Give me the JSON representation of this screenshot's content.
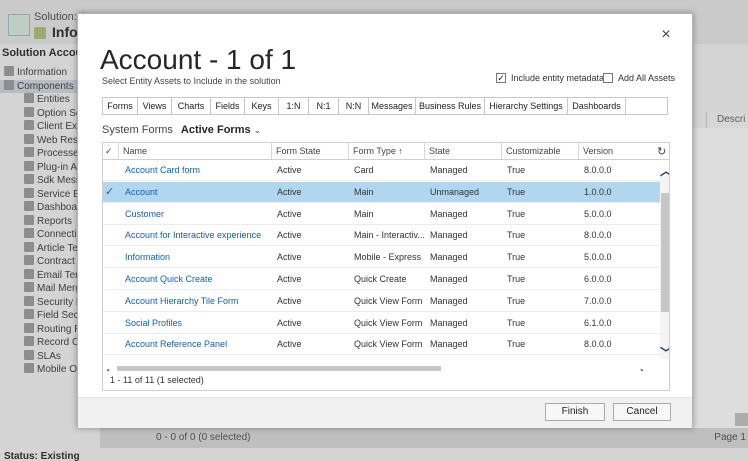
{
  "background": {
    "solution_label": "Solution: A",
    "info_title": "Infor",
    "solution_account": "Solution Account",
    "nav": {
      "information": "Information",
      "components": "Components",
      "items": [
        "Entities",
        "Option Set",
        "Client Exte",
        "Web Resou",
        "Processes",
        "Plug-in Ass",
        "Sdk Messag",
        "Service End",
        "Dashboard",
        "Reports",
        "Connection",
        "Article Tem",
        "Contract Te",
        "Email Temp",
        "Mail Merge",
        "Security Ro",
        "Field Secur",
        "Routing Ru",
        "Record Cre",
        "SLAs",
        "Mobile Offl"
      ]
    },
    "right_header": "Descri",
    "footer_count": "0 - 0 of 0 (0 selected)",
    "footer_page": "Page 1",
    "status": "Status: Existing"
  },
  "dialog": {
    "title": "Account - 1 of 1",
    "subtitle": "Select Entity Assets to Include in the solution",
    "close_glyph": "×",
    "include_metadata": {
      "label": "Include entity metadata",
      "checked": true
    },
    "add_all_assets": {
      "label": "Add All Assets",
      "checked": false
    },
    "tabs": [
      "Forms",
      "Views",
      "Charts",
      "Fields",
      "Keys",
      "1:N",
      "N:1",
      "N:N",
      "Messages",
      "Business Rules",
      "Hierarchy Settings",
      "Dashboards"
    ],
    "active_tab": "Forms",
    "view_label": "System Forms",
    "view_name": "Active Forms",
    "view_chevron": "⌄",
    "columns": {
      "check": "✓",
      "name": "Name",
      "form_state": "Form State",
      "form_type": "Form Type",
      "form_type_sort": "↑",
      "state": "State",
      "customizable": "Customizable",
      "version": "Version"
    },
    "refresh_glyph": "↻",
    "rows": [
      {
        "name": "Account Card form",
        "form_state": "Active",
        "form_type": "Card",
        "state": "Managed",
        "customizable": "True",
        "version": "8.0.0.0",
        "selected": false
      },
      {
        "name": "Account",
        "form_state": "Active",
        "form_type": "Main",
        "state": "Unmanaged",
        "customizable": "True",
        "version": "1.0.0.0",
        "selected": true
      },
      {
        "name": "Customer",
        "form_state": "Active",
        "form_type": "Main",
        "state": "Managed",
        "customizable": "True",
        "version": "5.0.0.0",
        "selected": false
      },
      {
        "name": "Account for Interactive experience",
        "form_state": "Active",
        "form_type": "Main - Interactiv...",
        "state": "Managed",
        "customizable": "True",
        "version": "8.0.0.0",
        "selected": false
      },
      {
        "name": "Information",
        "form_state": "Active",
        "form_type": "Mobile - Express",
        "state": "Managed",
        "customizable": "True",
        "version": "5.0.0.0",
        "selected": false
      },
      {
        "name": "Account Quick Create",
        "form_state": "Active",
        "form_type": "Quick Create",
        "state": "Managed",
        "customizable": "True",
        "version": "6.0.0.0",
        "selected": false
      },
      {
        "name": "Account Hierarchy Tile Form",
        "form_state": "Active",
        "form_type": "Quick View Form",
        "state": "Managed",
        "customizable": "True",
        "version": "7.0.0.0",
        "selected": false
      },
      {
        "name": "Social Profiles",
        "form_state": "Active",
        "form_type": "Quick View Form",
        "state": "Managed",
        "customizable": "True",
        "version": "6.1.0.0",
        "selected": false
      },
      {
        "name": "Account Reference Panel",
        "form_state": "Active",
        "form_type": "Quick View Form",
        "state": "Managed",
        "customizable": "True",
        "version": "8.0.0.0",
        "selected": false
      }
    ],
    "record_count": "1 - 11 of 11 (1 selected)",
    "finish_label": "Finish",
    "cancel_label": "Cancel"
  }
}
